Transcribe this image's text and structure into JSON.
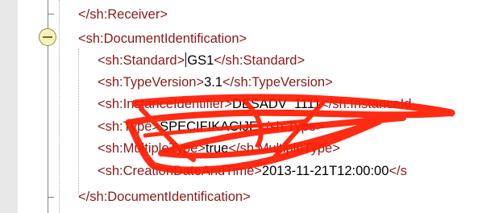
{
  "editor": {
    "lines": [
      {
        "open": "</sh:Receiver>",
        "text": "",
        "close": ""
      },
      {
        "open": "<sh:DocumentIdentification>",
        "text": "",
        "close": ""
      },
      {
        "open": "<sh:Standard>",
        "text": "GS1",
        "close": "</sh:Standard>"
      },
      {
        "open": "<sh:TypeVersion>",
        "text": "3.1",
        "close": "</sh:TypeVersion>"
      },
      {
        "open": "<sh:InstanceIdentifier>",
        "text": "DESADV_1111",
        "close": "</sh:InstanceId"
      },
      {
        "open": "<sh:Type>",
        "text": "SPECIFIKACIJE",
        "close": "</sh:Type>"
      },
      {
        "open": "<sh:MultipleType>",
        "text": "true",
        "close": "</sh:MultipleType>"
      },
      {
        "open": "<sh:CreationDateAndTime>",
        "text": "2013-11-21T12:00:00",
        "close": "</s"
      },
      {
        "open": "</sh:DocumentIdentification>",
        "text": "",
        "close": ""
      }
    ]
  },
  "colors": {
    "tag": "#8b1a1a",
    "text": "#000000",
    "gutter": "#e8e8e8",
    "fold_toggle": "#f7f3b8",
    "redaction": "#ff1a00"
  }
}
